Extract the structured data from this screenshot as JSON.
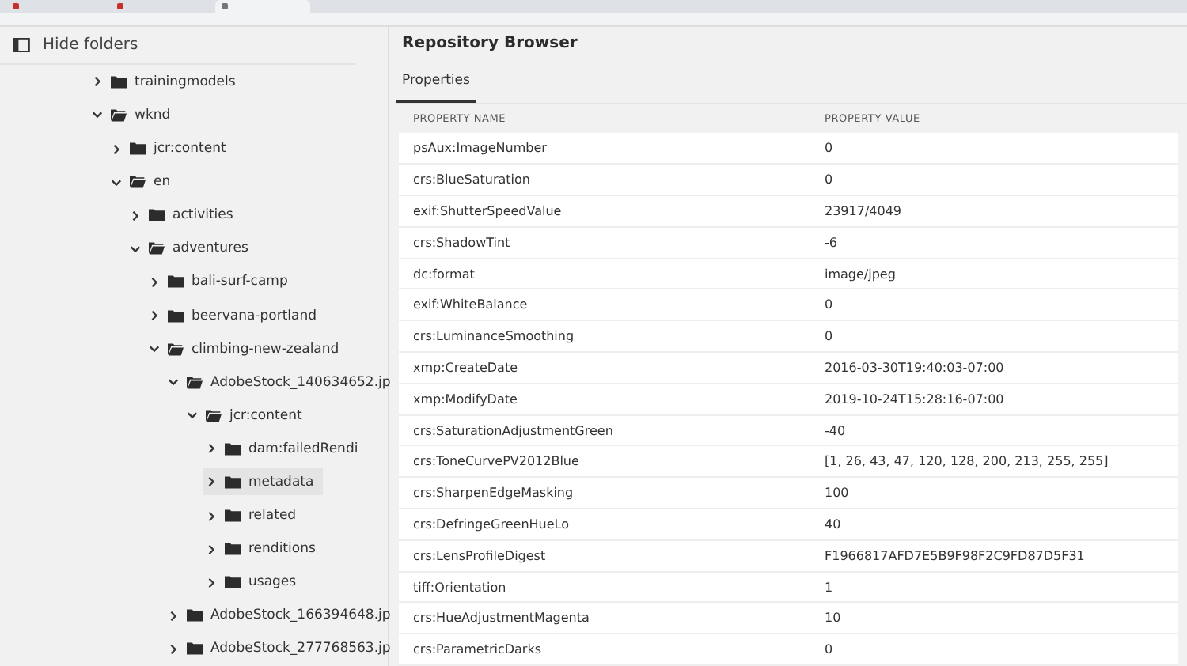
{
  "browser": {
    "tabs": [
      {
        "selected": false
      },
      {
        "selected": false
      },
      {
        "selected": true
      }
    ]
  },
  "sidebar": {
    "toggle_label": "Hide folders",
    "tree": [
      {
        "label": "trainingmodels",
        "expanded": false,
        "selected": false
      },
      {
        "label": "wknd",
        "expanded": true,
        "selected": false,
        "children": [
          {
            "label": "jcr:content",
            "expanded": false,
            "selected": false
          },
          {
            "label": "en",
            "expanded": true,
            "selected": false,
            "children": [
              {
                "label": "activities",
                "expanded": false,
                "selected": false
              },
              {
                "label": "adventures",
                "expanded": true,
                "selected": false,
                "children": [
                  {
                    "label": "bali-surf-camp",
                    "expanded": false,
                    "selected": false
                  },
                  {
                    "label": "beervana-portland",
                    "expanded": false,
                    "selected": false
                  },
                  {
                    "label": "climbing-new-zealand",
                    "expanded": true,
                    "selected": false,
                    "children": [
                      {
                        "label": "AdobeStock_140634652.jp",
                        "expanded": true,
                        "selected": false,
                        "children": [
                          {
                            "label": "jcr:content",
                            "expanded": true,
                            "selected": false,
                            "children": [
                              {
                                "label": "dam:failedRendi",
                                "expanded": false,
                                "selected": false
                              },
                              {
                                "label": "metadata",
                                "expanded": false,
                                "selected": true
                              },
                              {
                                "label": "related",
                                "expanded": false,
                                "selected": false
                              },
                              {
                                "label": "renditions",
                                "expanded": false,
                                "selected": false
                              },
                              {
                                "label": "usages",
                                "expanded": false,
                                "selected": false
                              }
                            ]
                          }
                        ]
                      },
                      {
                        "label": "AdobeStock_166394648.jp",
                        "expanded": false,
                        "selected": false
                      },
                      {
                        "label": "AdobeStock_277768563.jp",
                        "expanded": false,
                        "selected": false
                      }
                    ]
                  }
                ]
              }
            ]
          }
        ]
      }
    ]
  },
  "main": {
    "title": "Repository Browser",
    "tabs": [
      {
        "label": "Properties",
        "selected": true
      }
    ],
    "table": {
      "columns": [
        "PROPERTY NAME",
        "PROPERTY VALUE"
      ],
      "rows": [
        [
          "psAux:ImageNumber",
          "0"
        ],
        [
          "crs:BlueSaturation",
          "0"
        ],
        [
          "exif:ShutterSpeedValue",
          "23917/4049"
        ],
        [
          "crs:ShadowTint",
          "-6"
        ],
        [
          "dc:format",
          "image/jpeg"
        ],
        [
          "exif:WhiteBalance",
          "0"
        ],
        [
          "crs:LuminanceSmoothing",
          "0"
        ],
        [
          "xmp:CreateDate",
          "2016-03-30T19:40:03-07:00"
        ],
        [
          "xmp:ModifyDate",
          "2019-10-24T15:28:16-07:00"
        ],
        [
          "crs:SaturationAdjustmentGreen",
          "-40"
        ],
        [
          "crs:ToneCurvePV2012Blue",
          "[1, 26, 43, 47, 120, 128, 200, 213, 255, 255]"
        ],
        [
          "crs:SharpenEdgeMasking",
          "100"
        ],
        [
          "crs:DefringeGreenHueLo",
          "40"
        ],
        [
          "crs:LensProfileDigest",
          "F1966817AFD7E5B9F98F2C9FD87D5F31"
        ],
        [
          "tiff:Orientation",
          "1"
        ],
        [
          "crs:HueAdjustmentMagenta",
          "10"
        ],
        [
          "crs:ParametricDarks",
          "0"
        ]
      ]
    }
  }
}
